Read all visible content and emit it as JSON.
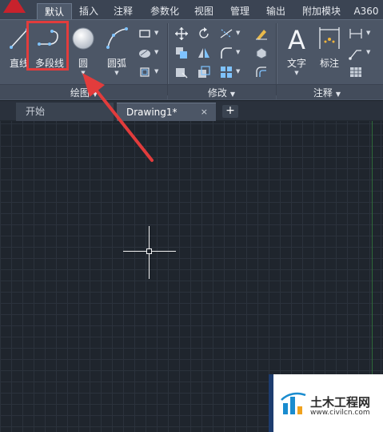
{
  "ribbon_tabs": [
    {
      "label": "默认"
    },
    {
      "label": "插入"
    },
    {
      "label": "注释"
    },
    {
      "label": "参数化"
    },
    {
      "label": "视图"
    },
    {
      "label": "管理"
    },
    {
      "label": "输出"
    },
    {
      "label": "附加模块"
    },
    {
      "label": "A360"
    }
  ],
  "draw_panel": {
    "title": "绘图",
    "tools": {
      "line": "直线",
      "polyline": "多段线",
      "circle": "圆",
      "arc": "圆弧"
    }
  },
  "modify_panel": {
    "title": "修改"
  },
  "annotation_panel": {
    "title": "注释",
    "tools": {
      "text": "文字",
      "dimension": "标注"
    }
  },
  "file_tabs": {
    "start": "开始",
    "drawing": "Drawing1*",
    "close_glyph": "×",
    "add_glyph": "+"
  },
  "watermark": {
    "title": "土木工程网",
    "url": "www.civilcn.com"
  },
  "colors": {
    "highlight": "#e23c3c",
    "arrow": "#e23c3c",
    "canvas": "#1f252d",
    "ribbon": "#4c5666"
  }
}
